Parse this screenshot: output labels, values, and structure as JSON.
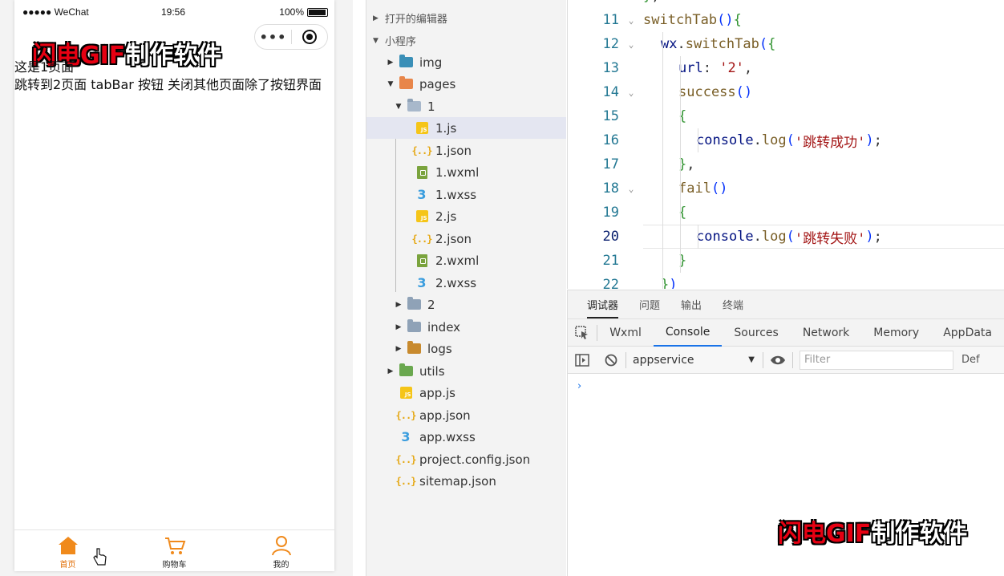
{
  "simulator": {
    "status": {
      "carrier": "●●●●● WeChat",
      "time": "19:56",
      "battery": "100%"
    },
    "nav_title": "WeChat",
    "capsule": {
      "more": "•••"
    },
    "body": {
      "line1": "这是1页面",
      "line2": "跳转到2页面 tabBar 按钮 关闭其他页面除了按钮界面"
    },
    "tabbar": [
      {
        "label": "首页",
        "icon": "home-icon",
        "active": true
      },
      {
        "label": "购物车",
        "icon": "cart-icon",
        "active": false
      },
      {
        "label": "我的",
        "icon": "user-icon",
        "active": false
      }
    ],
    "watermark": {
      "red": "闪电GIF",
      "white": "制作软件"
    }
  },
  "explorer": {
    "open_editors": "打开的编辑器",
    "project": "小程序",
    "tree": [
      {
        "label": "img",
        "icon": "folder-img-icon"
      },
      {
        "label": "pages",
        "icon": "folder-pages-icon"
      },
      {
        "label": "1",
        "icon": "folder-open-icon"
      },
      {
        "label": "1.js",
        "icon": "js-icon"
      },
      {
        "label": "1.json",
        "icon": "json-icon"
      },
      {
        "label": "1.wxml",
        "icon": "wxml-icon"
      },
      {
        "label": "1.wxss",
        "icon": "wxss-icon"
      },
      {
        "label": "2.js",
        "icon": "js-icon"
      },
      {
        "label": "2.json",
        "icon": "json-icon"
      },
      {
        "label": "2.wxml",
        "icon": "wxml-icon"
      },
      {
        "label": "2.wxss",
        "icon": "wxss-icon"
      },
      {
        "label": "2",
        "icon": "folder-icon"
      },
      {
        "label": "index",
        "icon": "folder-icon"
      },
      {
        "label": "logs",
        "icon": "folder-logs-icon"
      },
      {
        "label": "utils",
        "icon": "folder-utils-icon"
      },
      {
        "label": "app.js",
        "icon": "js-icon"
      },
      {
        "label": "app.json",
        "icon": "json-icon"
      },
      {
        "label": "app.wxss",
        "icon": "wxss-icon"
      },
      {
        "label": "project.config.json",
        "icon": "json-icon"
      },
      {
        "label": "sitemap.json",
        "icon": "json-icon"
      }
    ],
    "selected": "1.js"
  },
  "editor": {
    "lines": [
      {
        "n": "10",
        "code": "},"
      },
      {
        "n": "11",
        "code": "switchTab(){"
      },
      {
        "n": "12",
        "code": "wx.switchTab({"
      },
      {
        "n": "13",
        "code": "url: '2',"
      },
      {
        "n": "14",
        "code": "success()"
      },
      {
        "n": "15",
        "code": "{"
      },
      {
        "n": "16",
        "code": "console.log('跳转成功');"
      },
      {
        "n": "17",
        "code": "},"
      },
      {
        "n": "18",
        "code": "fail()"
      },
      {
        "n": "19",
        "code": "{"
      },
      {
        "n": "20",
        "code": "console.log('跳转失败');"
      },
      {
        "n": "21",
        "code": "}"
      },
      {
        "n": "22",
        "code": "})"
      }
    ],
    "current_line": "20"
  },
  "devtools": {
    "top_tabs": [
      "调试器",
      "问题",
      "输出",
      "终端"
    ],
    "tabs": [
      "Wxml",
      "Console",
      "Sources",
      "Network",
      "Memory",
      "AppData"
    ],
    "active_tab": "Console",
    "context": "appservice",
    "filter_placeholder": "Filter",
    "levels": "Def",
    "prompt": "›"
  },
  "watermark2": {
    "red": "闪电GIF",
    "white": "制作软件"
  }
}
